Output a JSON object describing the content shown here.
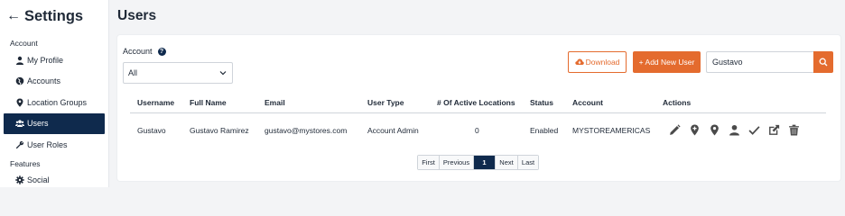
{
  "sidebar": {
    "title": "Settings",
    "back_icon": "arrow-left-icon",
    "sections": [
      {
        "label": "Account"
      },
      {
        "label": "Features"
      }
    ],
    "items": [
      {
        "label": "My Profile",
        "icon": "user-icon"
      },
      {
        "label": "Accounts",
        "icon": "globe-icon"
      },
      {
        "label": "Location Groups",
        "icon": "map-pin-icon"
      },
      {
        "label": "Users",
        "icon": "users-icon",
        "active": true
      },
      {
        "label": "User Roles",
        "icon": "wrench-icon"
      },
      {
        "label": "Social",
        "icon": "gear-icon"
      }
    ]
  },
  "page": {
    "title": "Users"
  },
  "filters": {
    "account_label": "Account",
    "help_icon": "?",
    "account_value": "All"
  },
  "toolbar": {
    "download_label": "Download",
    "add_user_label": "+ Add New User",
    "search_value": "Gustavo"
  },
  "table": {
    "headers": [
      "Username",
      "Full Name",
      "Email",
      "User Type",
      "# Of Active Locations",
      "Status",
      "Account",
      "Actions"
    ],
    "rows": [
      {
        "username": "Gustavo",
        "full_name": "Gustavo Ramirez",
        "email": "gustavo@mystores.com",
        "user_type": "Account Admin",
        "active_locations": "0",
        "status": "Enabled",
        "account": "MYSTOREAMERICAS",
        "actions": [
          "pencil-icon",
          "add-location-icon",
          "location-pin-icon",
          "user-icon",
          "check-icon",
          "external-link-icon",
          "trash-icon"
        ]
      }
    ]
  },
  "pagination": {
    "first": "First",
    "previous": "Previous",
    "current": "1",
    "next": "Next",
    "last": "Last"
  },
  "colors": {
    "accent": "#e46b2e",
    "navy": "#0f2a4d",
    "background": "#f3f4f6"
  }
}
